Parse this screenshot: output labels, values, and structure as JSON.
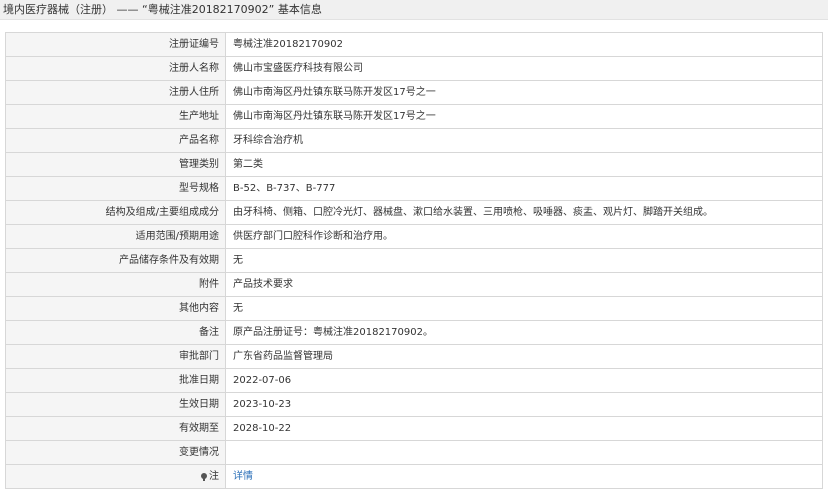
{
  "header": {
    "title": "境内医疗器械（注册） —— “粤械注准20182170902” 基本信息"
  },
  "rows": [
    {
      "label": "注册证编号",
      "value": "粤械注准20182170902"
    },
    {
      "label": "注册人名称",
      "value": "佛山市宝盛医疗科技有限公司"
    },
    {
      "label": "注册人住所",
      "value": "佛山市南海区丹灶镇东联马陈开发区17号之一"
    },
    {
      "label": "生产地址",
      "value": "佛山市南海区丹灶镇东联马陈开发区17号之一"
    },
    {
      "label": "产品名称",
      "value": "牙科综合治疗机"
    },
    {
      "label": "管理类别",
      "value": "第二类"
    },
    {
      "label": "型号规格",
      "value": "B-52、B-737、B-777"
    },
    {
      "label": "结构及组成/主要组成成分",
      "value": "由牙科椅、侧箱、口腔冷光灯、器械盘、漱口给水装置、三用喷枪、吸唾器、痰盂、观片灯、脚踏开关组成。"
    },
    {
      "label": "适用范围/预期用途",
      "value": "供医疗部门口腔科作诊断和治疗用。"
    },
    {
      "label": "产品储存条件及有效期",
      "value": "无"
    },
    {
      "label": "附件",
      "value": "产品技术要求"
    },
    {
      "label": "其他内容",
      "value": "无"
    },
    {
      "label": "备注",
      "value": "原产品注册证号：粤械注准20182170902。"
    },
    {
      "label": "审批部门",
      "value": "广东省药品监督管理局"
    },
    {
      "label": "批准日期",
      "value": "2022-07-06"
    },
    {
      "label": "生效日期",
      "value": "2023-10-23"
    },
    {
      "label": "有效期至",
      "value": "2028-10-22"
    },
    {
      "label": "变更情况",
      "value": ""
    }
  ],
  "note_row": {
    "icon": "pin-icon",
    "label": "注",
    "link_text": "详情"
  }
}
